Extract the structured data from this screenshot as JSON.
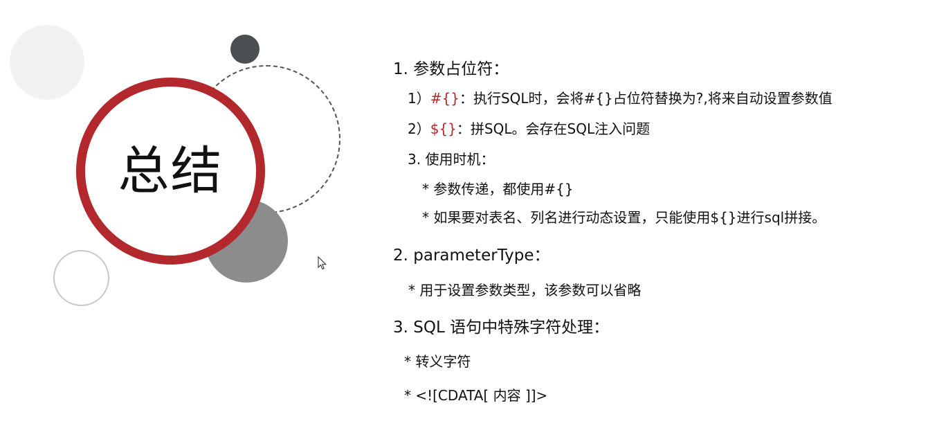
{
  "title": "总结",
  "sections": [
    {
      "heading": "1. 参数占位符：",
      "items": [
        {
          "prefix": "1）",
          "code": "#{}",
          "text": "：执行SQL时，会将#{}占位符替换为?,将来自动设置参数值"
        },
        {
          "prefix": "2）",
          "code": "${}",
          "text": "：拼SQL。会存在SQL注入问题"
        },
        {
          "text": "3. 使用时机："
        },
        {
          "text": "* 参数传递，都使用#{}"
        },
        {
          "text": "* 如果要对表名、列名进行动态设置，只能使用${}进行sql拼接。"
        }
      ]
    },
    {
      "heading": "2. parameterType：",
      "items": [
        {
          "text": "* 用于设置参数类型，该参数可以省略"
        }
      ]
    },
    {
      "heading": "3. SQL 语句中特殊字符处理：",
      "items": [
        {
          "text": "* 转义字符"
        },
        {
          "text": "*  <![CDATA[ 内容 ]]>"
        }
      ]
    }
  ],
  "colors": {
    "accent_red": "#b3282d",
    "dark_circle": "#4a4f51",
    "gray_circle": "#8c8c8c"
  },
  "icons": [
    "mouse-pointer-icon"
  ]
}
